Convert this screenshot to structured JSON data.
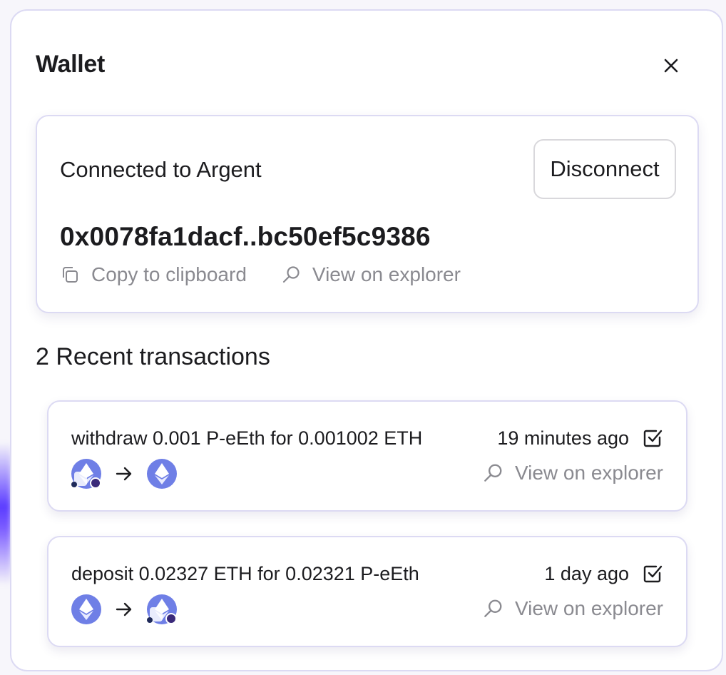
{
  "modal": {
    "title": "Wallet",
    "close_icon": "close-icon"
  },
  "account": {
    "connected_text": "Connected to Argent",
    "disconnect_label": "Disconnect",
    "address": "0x0078fa1dacf..bc50ef5c9386",
    "copy_label": "Copy to clipboard",
    "explorer_label": "View on explorer"
  },
  "transactions": {
    "title": "2 Recent transactions",
    "items": [
      {
        "description": "withdraw 0.001 P-eEth for 0.001002 ETH",
        "time": "19 minutes ago",
        "explorer_label": "View on explorer",
        "from_token": "p-eeth-token-icon",
        "to_token": "eth-token-icon",
        "status_icon": "checkbox-checked-icon"
      },
      {
        "description": "deposit 0.02327 ETH for 0.02321 P-eEth",
        "time": "1 day ago",
        "explorer_label": "View on explorer",
        "from_token": "eth-token-icon",
        "to_token": "p-eeth-token-icon",
        "status_icon": "checkbox-checked-icon"
      }
    ]
  },
  "colors": {
    "accent": "#6f7fe6",
    "border": "#dcdaf3",
    "muted_text": "#8a8a90",
    "text": "#1c1c1f"
  }
}
